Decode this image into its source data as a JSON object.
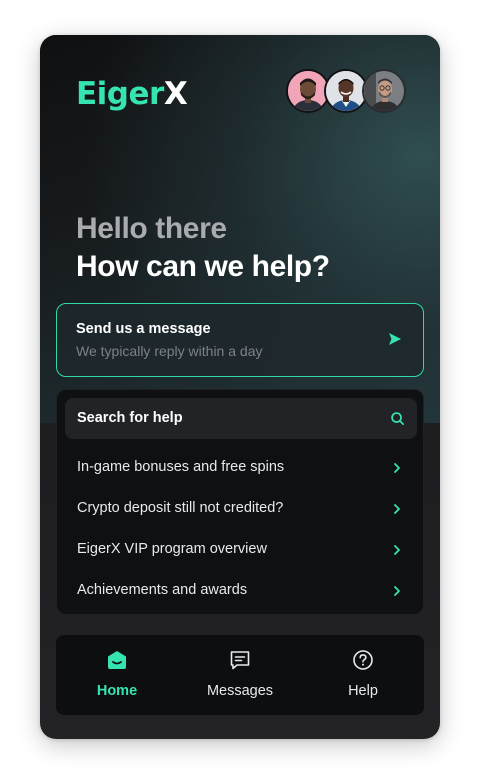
{
  "brand": {
    "logo_main": "Eiger",
    "logo_x": "X",
    "accent": "#36e4b2"
  },
  "header": {
    "greeting": "Hello there",
    "question": "How can we help?"
  },
  "send_card": {
    "title": "Send us a message",
    "subtitle": "We typically reply within a day",
    "icon": "send-arrow-icon"
  },
  "search": {
    "label": "Search for help",
    "icon": "search-icon"
  },
  "help_items": [
    {
      "label": "In-game bonuses and free spins"
    },
    {
      "label": "Crypto deposit still not credited?"
    },
    {
      "label": "EigerX VIP program overview"
    },
    {
      "label": "Achievements and awards"
    }
  ],
  "nav": [
    {
      "label": "Home",
      "icon": "home-icon",
      "active": true
    },
    {
      "label": "Messages",
      "icon": "messages-icon",
      "active": false
    },
    {
      "label": "Help",
      "icon": "help-icon",
      "active": false
    }
  ]
}
